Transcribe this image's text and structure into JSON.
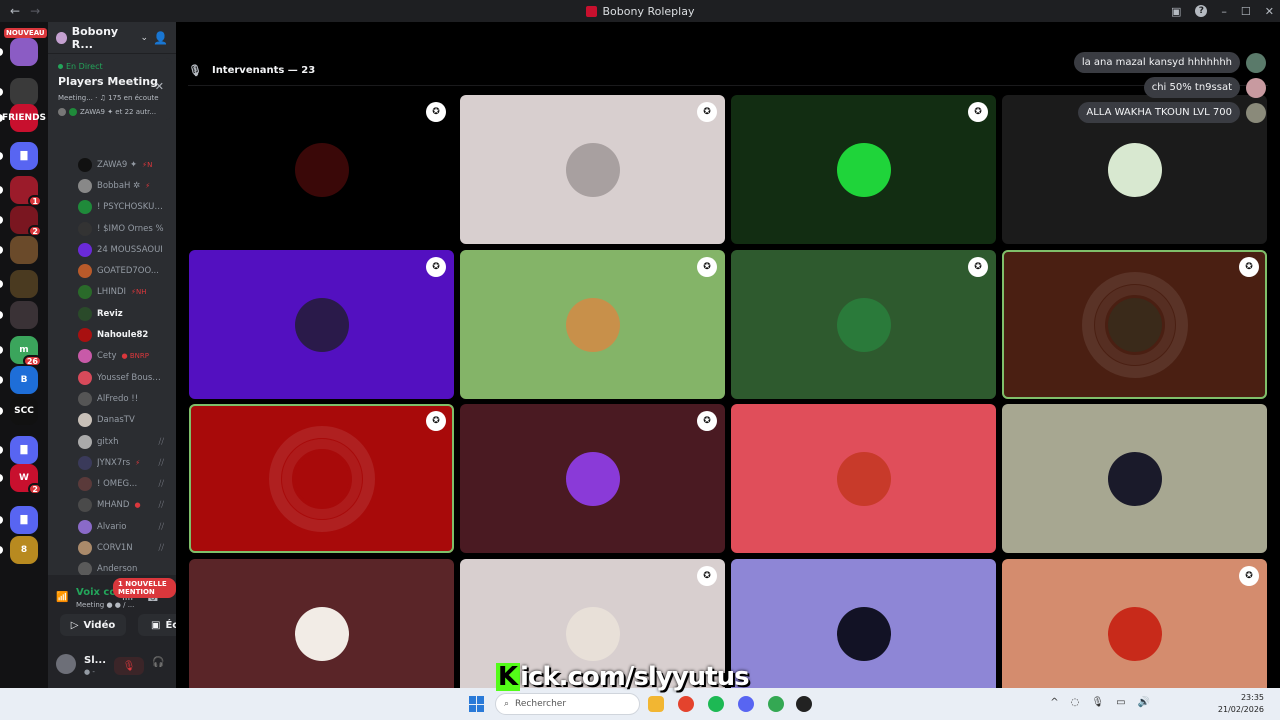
{
  "window": {
    "title": "Bobony Roleplay",
    "nav_back": "←",
    "nav_forward": "→",
    "controls": {
      "inbox": "▣",
      "help": "?",
      "minimize": "–",
      "maximize": "☐",
      "close": "✕"
    }
  },
  "rail": {
    "new_badge": "NOUVEAU",
    "servers": [
      {
        "label": "",
        "color": "#8b5cc4"
      },
      {
        "label": "",
        "color": "#3a3a3a"
      },
      {
        "label": "FRIENDS",
        "color": "#c8102e"
      },
      {
        "label": "▇",
        "color": "#5865f2"
      },
      {
        "label": "",
        "color": "#9b1b2a",
        "badge": "1"
      },
      {
        "label": "",
        "color": "#7a1620",
        "badge": "2"
      },
      {
        "label": "",
        "color": "#6a4a2a"
      },
      {
        "label": "",
        "color": "#4a3a20"
      },
      {
        "label": "",
        "color": "#3a3236"
      },
      {
        "label": "m",
        "color": "#3ba55c",
        "badge": "26"
      },
      {
        "label": "B",
        "color": "#1e6ed8"
      },
      {
        "label": "SCC",
        "color": "#111"
      },
      {
        "label": "▇",
        "color": "#5865f2"
      },
      {
        "label": "W",
        "color": "#c8102e",
        "badge": "2"
      },
      {
        "label": "▇",
        "color": "#5865f2"
      },
      {
        "label": "8",
        "color": "#b88a20"
      }
    ]
  },
  "sidebar": {
    "guild_name": "Bobony R...",
    "guild_chevron": "⌄",
    "invite_icon": "👤",
    "event": {
      "live_label": "En Direct",
      "close": "✕",
      "title": "Players Meeting",
      "meta": "Meeting... · ♫ 175 en écoute",
      "speakers": "ZAWA9 ✦ et 22 autr..."
    },
    "members": [
      {
        "name": "ZAWA9 ✦",
        "suffix": "⚡N",
        "color": "#111"
      },
      {
        "name": "BobbaH ✲",
        "suffix": "⚡",
        "color": "#888"
      },
      {
        "name": "! PSYCHOSKULLS...",
        "suffix": "",
        "color": "#1f8a3a"
      },
      {
        "name": "! $IMO Ornes %",
        "suffix": "",
        "color": "#333"
      },
      {
        "name": "24 MOUSSAOUI",
        "suffix": "",
        "color": "#6a2ad8"
      },
      {
        "name": "GOATED7OO...",
        "suffix": "",
        "color": "#b85a2a"
      },
      {
        "name": "LHINDI",
        "suffix": "⚡NH",
        "color": "#2a6a2a"
      },
      {
        "name": "Reviz",
        "suffix": "",
        "color": "#2a4a2a",
        "bold": true
      },
      {
        "name": "Nahoule82",
        "suffix": "",
        "color": "#a81010",
        "bold": true
      },
      {
        "name": "Cety",
        "suffix": "● BNRP",
        "color": "#c85aa8"
      },
      {
        "name": "Youssef Boush...",
        "suffix": "",
        "color": "#d84a5a"
      },
      {
        "name": "AlFredo !!",
        "suffix": "",
        "color": "#555"
      },
      {
        "name": "DanasTV",
        "suffix": "",
        "color": "#c8c0b8"
      },
      {
        "name": "gitxh",
        "suffix": "",
        "color": "#aaa",
        "muted": true
      },
      {
        "name": "JYNX7rs",
        "suffix": "⚡",
        "color": "#3a3a5a",
        "muted": true
      },
      {
        "name": "! OMEG...",
        "suffix": "",
        "color": "#5a3a3a",
        "muted": true
      },
      {
        "name": "MHAND",
        "suffix": "●",
        "color": "#4a4a4a",
        "muted": true
      },
      {
        "name": "Alvario",
        "suffix": "",
        "color": "#8a6ac8",
        "muted": true
      },
      {
        "name": "CORV1N",
        "suffix": "",
        "color": "#aa8a6a",
        "muted": true
      },
      {
        "name": "Anderson",
        "suffix": "",
        "color": "#5a5a5a"
      }
    ],
    "mention_pill": "1 NOUVELLE MENTION",
    "voice": {
      "status": "Voix connectée",
      "channel": "Meeting ● ● / ...",
      "video_label": "Vidéo",
      "screen_label": "Écran"
    },
    "user": {
      "name": "Sl...",
      "status": "● -"
    }
  },
  "main": {
    "header_label": "Intervenants — 23",
    "chat": [
      {
        "text": "la ana mazal kansyd hhhhhhh",
        "avatar_color": "#5a7a6a"
      },
      {
        "text": "chi 50% tn9ssat",
        "avatar_color": "#c89aa0"
      },
      {
        "text": "ALLA WAKHA TKOUN LVL 700",
        "avatar_color": "#8a8a7a"
      }
    ],
    "tiles": [
      {
        "bg": "#000000",
        "avatar": "#3a0808",
        "mod": true,
        "speaking": false
      },
      {
        "bg": "#d8cfcf",
        "avatar": "#a8a0a0",
        "mod": true,
        "speaking": false
      },
      {
        "bg": "#122d12",
        "avatar": "#1fd43a",
        "mod": true,
        "speaking": false
      },
      {
        "bg": "#1b1b1b",
        "avatar": "#d8e8d0",
        "mod": false,
        "speaking": false
      },
      {
        "bg": "#5310c0",
        "avatar": "#2a1a4a",
        "mod": true,
        "speaking": false
      },
      {
        "bg": "#84b468",
        "avatar": "#c8904a",
        "mod": true,
        "speaking": false
      },
      {
        "bg": "#2e5a2e",
        "avatar": "#2a7a3a",
        "mod": true,
        "speaking": false
      },
      {
        "bg": "#4a1f12",
        "avatar": "#3a2a1a",
        "mod": true,
        "speaking": true,
        "ring": true
      },
      {
        "bg": "#a80a0a",
        "avatar": "#a80a0a",
        "mod": true,
        "speaking": true,
        "ring": true
      },
      {
        "bg": "#4a1a22",
        "avatar": "#8a3ad8",
        "mod": true,
        "speaking": false
      },
      {
        "bg": "#e04e5a",
        "avatar": "#c83a2a",
        "mod": false,
        "speaking": false
      },
      {
        "bg": "#a7a791",
        "avatar": "#1a1a2a",
        "mod": false,
        "speaking": false
      },
      {
        "bg": "#5a2528",
        "avatar": "#f2ece6",
        "mod": false,
        "speaking": false
      },
      {
        "bg": "#d8cfcf",
        "avatar": "#e8e0d8",
        "mod": true,
        "speaking": false
      },
      {
        "bg": "#8e86d6",
        "avatar": "#121225",
        "mod": false,
        "speaking": false
      },
      {
        "bg": "#d48c6e",
        "avatar": "#c82a1a",
        "mod": true,
        "speaking": false
      }
    ],
    "mod_icon": "✪"
  },
  "overlay": {
    "kick_k": "K",
    "kick_text": "ick.com/slyyutus"
  },
  "taskbar": {
    "search_placeholder": "Rechercher",
    "search_icon": "⌕",
    "tray": [
      "^",
      "◌",
      "🎙",
      "▭",
      "🔊"
    ],
    "time": "23:35",
    "date": "21/02/2026"
  }
}
